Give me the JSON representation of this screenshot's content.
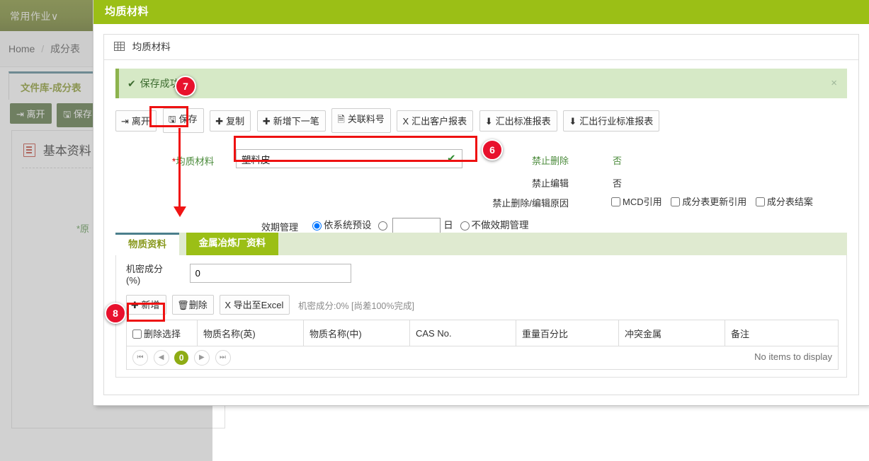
{
  "background": {
    "topnav_item": "常用作业∨",
    "breadcrumb": {
      "home": "Home",
      "sep": "/",
      "current": "成分表"
    },
    "tab_label": "文件库-成分表",
    "buttons": [
      {
        "icon": "exit-icon",
        "glyph": "⇥",
        "label": "离开"
      },
      {
        "icon": "save-icon",
        "glyph": "🖫",
        "label": "保存"
      }
    ],
    "panel_title": "基本资料",
    "required_label": "*原"
  },
  "modal": {
    "title": "均质材料",
    "card_header": "均质材料",
    "alert": {
      "check": "✔",
      "text": "保存成功",
      "close": "×"
    },
    "toolbar": [
      {
        "icon": "exit-icon",
        "glyph": "⇥",
        "label": "离开"
      },
      {
        "icon": "save-icon",
        "glyph": "🖫",
        "label": "保存"
      },
      {
        "icon": "plus-icon",
        "glyph": "✚",
        "label": "复制"
      },
      {
        "icon": "plus-icon",
        "glyph": "✚",
        "label": "新增下一笔"
      },
      {
        "icon": "document-icon",
        "glyph": "🗎",
        "label": "关联料号"
      },
      {
        "icon": "excel-icon",
        "glyph": "X",
        "label": "汇出客户报表"
      },
      {
        "icon": "download-icon",
        "glyph": "⬇",
        "label": "汇出标准报表"
      },
      {
        "icon": "download-icon",
        "glyph": "⬇",
        "label": "汇出行业标准报表"
      }
    ],
    "form": {
      "material_label": "均质材料",
      "material_required_mark": "*",
      "material_value": "塑料皮",
      "material_valid_mark": "✔",
      "forbid_delete_label": "禁止删除",
      "forbid_delete_value": "否",
      "forbid_edit_label": "禁止编辑",
      "forbid_edit_value": "否",
      "forbid_reason_label": "禁止删除/编辑原因",
      "reason_options": [
        {
          "label": "MCD引用",
          "checked": false
        },
        {
          "label": "成分表更新引用",
          "checked": false
        },
        {
          "label": "成分表结案",
          "checked": false
        }
      ],
      "validity_label": "效期管理",
      "validity_options": [
        {
          "label": "依系统预设",
          "checked": true
        },
        {
          "label": "",
          "checked": false
        },
        {
          "label": "不做效期管理",
          "checked": false
        }
      ],
      "validity_days_value": "",
      "validity_days_unit": "日"
    },
    "tabs": [
      {
        "label": "物质资料",
        "active": true
      },
      {
        "label": "金属冶炼厂资料",
        "active": false
      }
    ],
    "confidential": {
      "label_line1": "机密成分",
      "label_line2": "(%)",
      "value": "0"
    },
    "grid_toolbar": [
      {
        "icon": "plus-icon",
        "glyph": "✚",
        "label": "新增"
      },
      {
        "icon": "trash-icon",
        "glyph": "🗑",
        "label": "删除"
      },
      {
        "icon": "excel-icon",
        "glyph": "X",
        "label": "导出至Excel"
      }
    ],
    "grid_note": "机密成分:0% [尚差100%完成]",
    "grid": {
      "columns": [
        "删除选择",
        "物质名称(英)",
        "物质名称(中)",
        "CAS No.",
        "重量百分比",
        "冲突金属",
        "备注"
      ],
      "rows": [],
      "empty_text": "No items to display",
      "pager": {
        "first": "⏮",
        "prev": "◀",
        "current": "0",
        "next": "▶",
        "last": "⏭"
      }
    }
  },
  "annotations": {
    "badges": [
      {
        "id": "6",
        "label": "6"
      },
      {
        "id": "7",
        "label": "7"
      },
      {
        "id": "8",
        "label": "8"
      }
    ]
  },
  "colors": {
    "brand_green": "#9bbf16",
    "nav_olive": "#6f801f",
    "alert_bg": "#d6e9c6",
    "alert_border": "#8db34e",
    "annotation_red": "#ee1111",
    "badge_red": "#e8112d",
    "tab_top_border": "#4b7f8c"
  }
}
